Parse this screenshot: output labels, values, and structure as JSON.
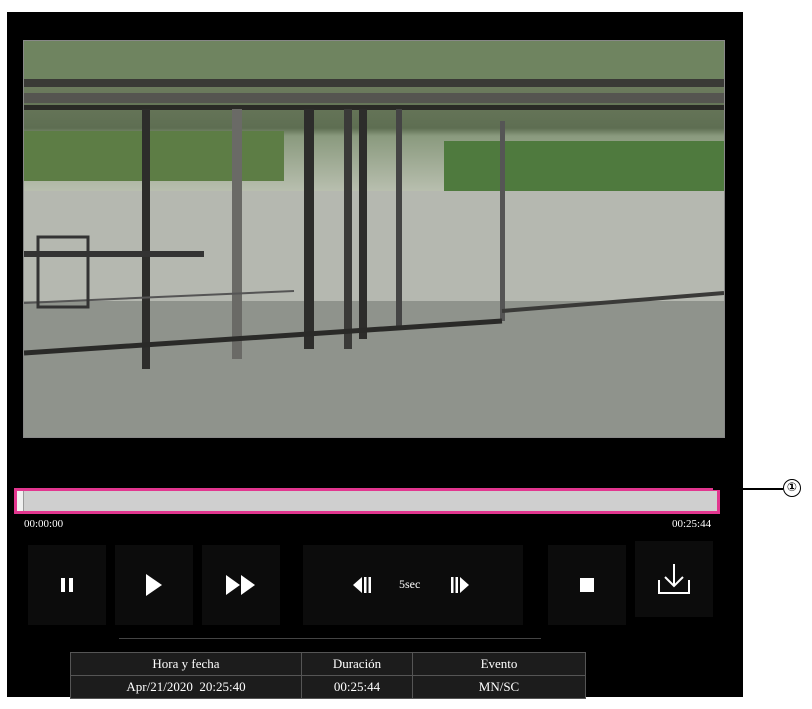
{
  "seekbar": {
    "start_time": "00:00:00",
    "end_time": "00:25:44",
    "position_fraction": 0.0
  },
  "callout": {
    "marker": "①"
  },
  "controls": {
    "pause_icon": "pause-icon",
    "play_icon": "play-icon",
    "fast_forward_icon": "fast-forward-icon",
    "skip_back_icon": "skip-back-icon",
    "skip_label": "5sec",
    "skip_forward_icon": "skip-forward-icon",
    "stop_icon": "stop-icon",
    "download_icon": "download-icon"
  },
  "info_table": {
    "headers": [
      "Hora y fecha",
      "Duración",
      "Evento"
    ],
    "values": [
      "Apr/21/2020  20:25:40",
      "00:25:44",
      "MN/SC"
    ]
  },
  "colors": {
    "highlight": "#e2368f",
    "background": "#000000"
  }
}
